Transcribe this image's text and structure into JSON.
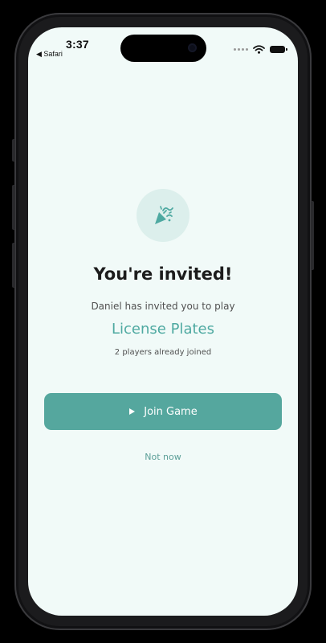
{
  "status_bar": {
    "time": "3:37",
    "back_app": "◀ Safari",
    "signal_icon": "signal-dots-icon",
    "wifi_icon": "wifi-icon",
    "battery_icon": "battery-icon"
  },
  "invite": {
    "icon": "party-popper-icon",
    "title": "You're invited!",
    "subtitle": "Daniel has invited you to play",
    "game_name": "License Plates",
    "players_joined": "2 players already joined"
  },
  "actions": {
    "join_icon": "play-icon",
    "join_label": "Join Game",
    "not_now_label": "Not now"
  },
  "colors": {
    "background": "#f1faf8",
    "accent": "#55a79e",
    "game_name": "#4ea9a1",
    "icon_circle": "#dcefec"
  }
}
